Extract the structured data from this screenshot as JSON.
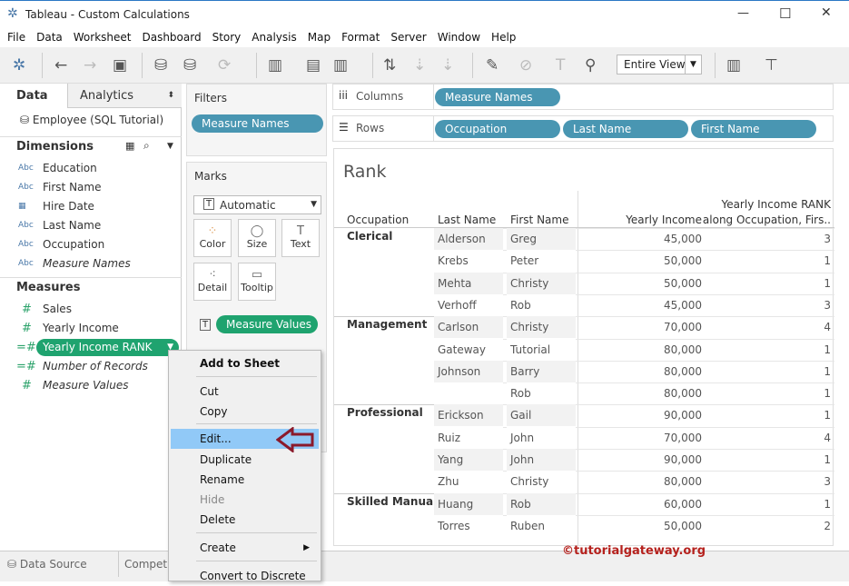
{
  "window": {
    "title": "Tableau - Custom Calculations",
    "min": "—",
    "max": "☐",
    "close": "✕"
  },
  "menu": [
    "File",
    "Data",
    "Worksheet",
    "Dashboard",
    "Story",
    "Analysis",
    "Map",
    "Format",
    "Server",
    "Window",
    "Help"
  ],
  "toolbar": {
    "fit": "Entire View"
  },
  "left": {
    "tab_data": "Data",
    "tab_analytics": "Analytics",
    "datasource": "Employee (SQL Tutorial)",
    "dimensions_title": "Dimensions",
    "measures_title": "Measures",
    "dimensions": [
      {
        "type": "Abc",
        "label": "Education"
      },
      {
        "type": "Abc",
        "label": "First Name"
      },
      {
        "type": "date",
        "label": "Hire Date"
      },
      {
        "type": "Abc",
        "label": "Last Name"
      },
      {
        "type": "Abc",
        "label": "Occupation"
      },
      {
        "type": "Abc",
        "label": "Measure Names",
        "italic": true
      }
    ],
    "measures": [
      {
        "label": "Sales"
      },
      {
        "label": "Yearly Income"
      },
      {
        "label": "Yearly Income RANK",
        "selected": true
      },
      {
        "label": "Number of Records",
        "italic": true
      },
      {
        "label": "Measure Values",
        "italic": true
      }
    ]
  },
  "filters": {
    "title": "Filters",
    "pill": "Measure Names"
  },
  "marks": {
    "title": "Marks",
    "type": "Automatic",
    "buttons": [
      "Color",
      "Size",
      "Text",
      "Detail",
      "Tooltip"
    ],
    "pill": "Measure Values"
  },
  "shelves": {
    "columns_label": "Columns",
    "rows_label": "Rows",
    "columns": [
      "Measure Names"
    ],
    "rows": [
      "Occupation",
      "Last Name",
      "First Name"
    ]
  },
  "context_menu": [
    "Add to Sheet",
    "Cut",
    "Copy",
    "Edit...",
    "Duplicate",
    "Rename",
    "Hide",
    "Delete",
    "Create",
    "Convert to Discrete"
  ],
  "view": {
    "title": "Rank",
    "headers": [
      "Occupation",
      "Last Name",
      "First Name",
      "Yearly Income",
      "Yearly Income RANK",
      "along Occupation, Firs.."
    ],
    "rows": [
      [
        "Clerical",
        "Alderson",
        "Greg",
        "45,000",
        "3"
      ],
      [
        "",
        "Krebs",
        "Peter",
        "50,000",
        "1"
      ],
      [
        "",
        "Mehta",
        "Christy",
        "50,000",
        "1"
      ],
      [
        "",
        "Verhoff",
        "Rob",
        "45,000",
        "3"
      ],
      [
        "Management",
        "Carlson",
        "Christy",
        "70,000",
        "4"
      ],
      [
        "",
        "Gateway",
        "Tutorial",
        "80,000",
        "1"
      ],
      [
        "",
        "Johnson",
        "Barry",
        "80,000",
        "1"
      ],
      [
        "",
        "",
        "Rob",
        "80,000",
        "1"
      ],
      [
        "Professional",
        "Erickson",
        "Gail",
        "90,000",
        "1"
      ],
      [
        "",
        "Ruiz",
        "John",
        "70,000",
        "4"
      ],
      [
        "",
        "Yang",
        "John",
        "90,000",
        "1"
      ],
      [
        "",
        "Zhu",
        "Christy",
        "80,000",
        "3"
      ],
      [
        "Skilled Manual",
        "Huang",
        "Rob",
        "60,000",
        "1"
      ],
      [
        "",
        "Torres",
        "Ruben",
        "50,000",
        "2"
      ]
    ]
  },
  "bottom": {
    "datasource": "Data Source",
    "sheet": "Competi"
  },
  "watermark": "©tutorialgateway.org"
}
